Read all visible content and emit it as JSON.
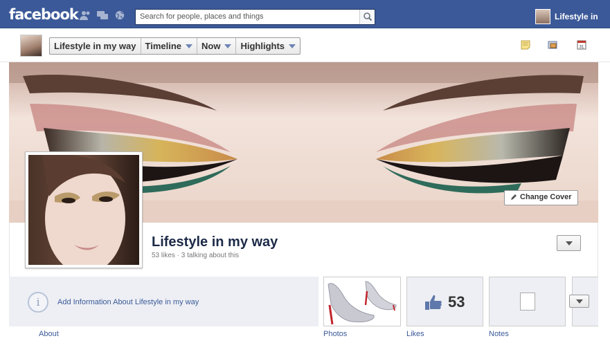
{
  "topbar": {
    "logo": "facebook",
    "search_placeholder": "Search for people, places and things",
    "user_name": "Lifestyle in"
  },
  "nav": {
    "crumbs": [
      "Lifestyle in my way",
      "Timeline",
      "Now",
      "Highlights"
    ]
  },
  "cover": {
    "change_cover_label": "Change Cover"
  },
  "page": {
    "name": "Lifestyle in my way",
    "meta": "53 likes · 3 talking about this"
  },
  "apps": {
    "about_cta": "Add Information About Lifestyle in my way",
    "about_label": "About",
    "photos_label": "Photos",
    "likes_label": "Likes",
    "likes_count": "53",
    "notes_label": "Notes"
  },
  "colors": {
    "brand": "#3b5998",
    "link": "#3b5998"
  }
}
